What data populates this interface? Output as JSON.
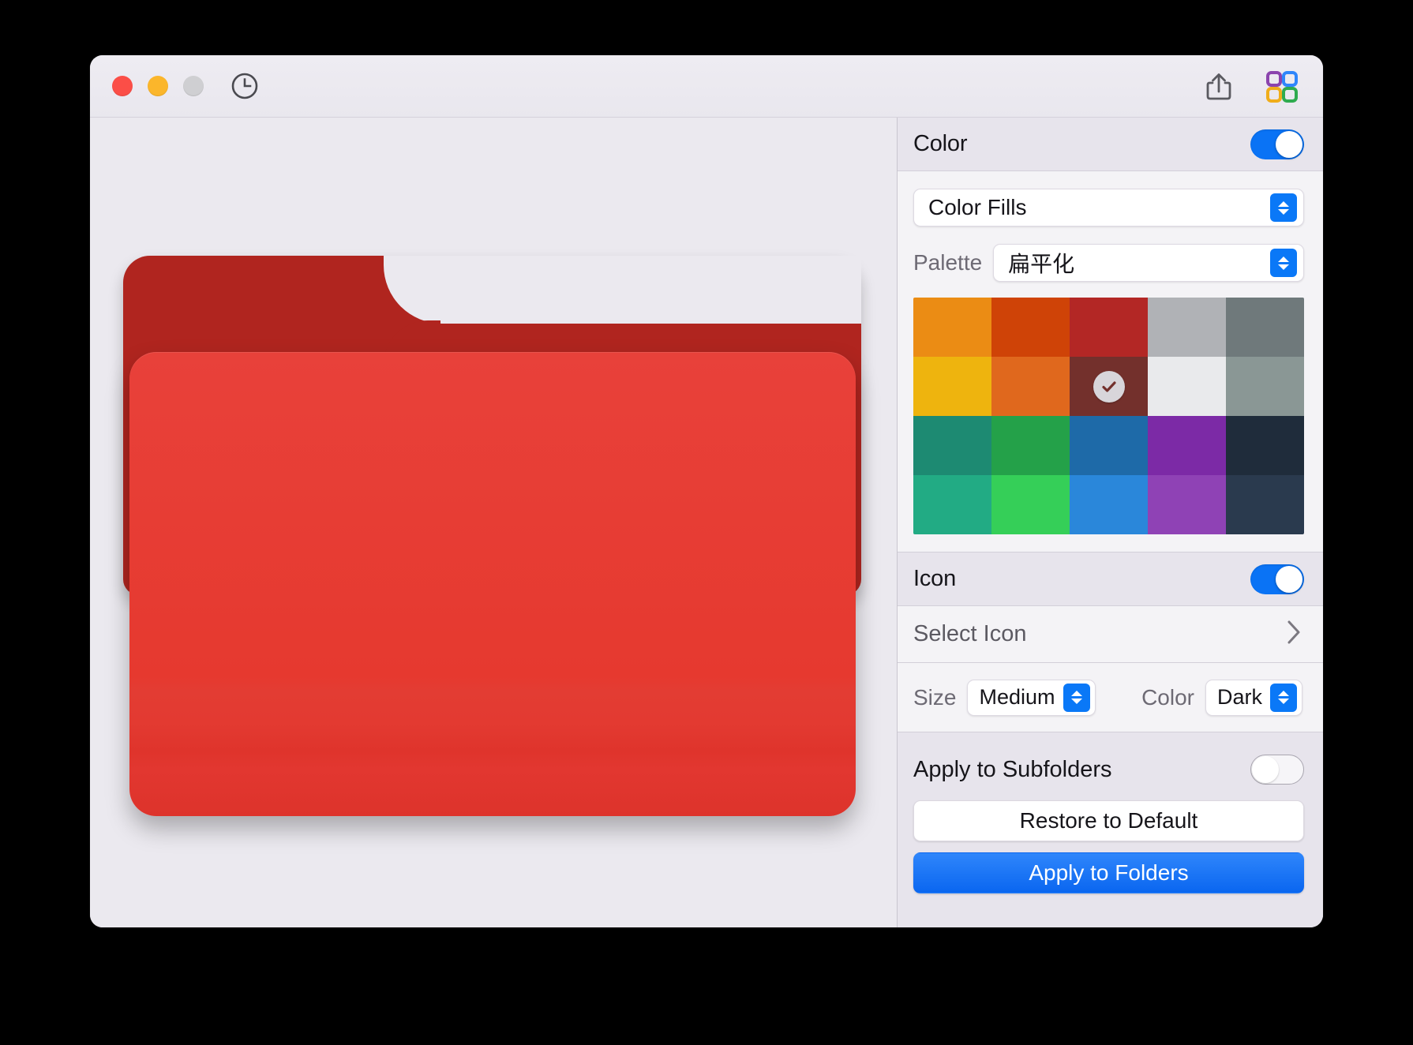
{
  "window": {
    "traffic_lights": [
      {
        "name": "close",
        "color": "#fb4e47"
      },
      {
        "name": "minimize",
        "color": "#fbb62b"
      },
      {
        "name": "zoom",
        "color": "#cfcfd2"
      }
    ],
    "toolbar_left_icon": "clock-icon",
    "toolbar_right_icons": [
      "share-icon",
      "color-grid-icon"
    ],
    "grid_icon_colors": [
      "#8b44ad",
      "#2f86fb",
      "#f0ad1a",
      "#2fab4f"
    ]
  },
  "preview": {
    "folder_back_color": "#b0251f",
    "folder_front_color": "#e53a31",
    "background": "#ebe9ef"
  },
  "color_section": {
    "title": "Color",
    "enabled": true,
    "kind": {
      "value": "Color Fills"
    },
    "palette": {
      "label": "Palette",
      "value": "扁平化"
    },
    "swatches": [
      {
        "color": "#eb8c14",
        "selected": false
      },
      {
        "color": "#cf4307",
        "selected": false
      },
      {
        "color": "#b32725",
        "selected": false
      },
      {
        "color": "#b0b2b6",
        "selected": false
      },
      {
        "color": "#6f797b",
        "selected": false
      },
      {
        "color": "#eeb40e",
        "selected": false
      },
      {
        "color": "#e0681d",
        "selected": false
      },
      {
        "color": "#73302c",
        "selected": true
      },
      {
        "color": "#e9eaec",
        "selected": false
      },
      {
        "color": "#8a9795",
        "selected": false
      },
      {
        "color": "#1d8a72",
        "selected": false
      },
      {
        "color": "#24a149",
        "selected": false
      },
      {
        "color": "#1e6aa8",
        "selected": false
      },
      {
        "color": "#7c2aa6",
        "selected": false
      },
      {
        "color": "#1f2c3b",
        "selected": false
      },
      {
        "color": "#22ab84",
        "selected": false
      },
      {
        "color": "#35cf58",
        "selected": false
      },
      {
        "color": "#2a87da",
        "selected": false
      },
      {
        "color": "#8f42b5",
        "selected": false
      },
      {
        "color": "#2a3a4e",
        "selected": false
      }
    ],
    "selected_swatch_index": 7,
    "accent": "#0a73f5"
  },
  "icon_section": {
    "title": "Icon",
    "enabled": true,
    "select_icon_label": "Select Icon",
    "size": {
      "label": "Size",
      "value": "Medium"
    },
    "color": {
      "label": "Color",
      "value": "Dark"
    }
  },
  "footer": {
    "apply_subfolders_label": "Apply to Subfolders",
    "apply_subfolders_enabled": false,
    "restore_label": "Restore to Default",
    "apply_label": "Apply to Folders",
    "apply_accent": "#0a66f0"
  }
}
